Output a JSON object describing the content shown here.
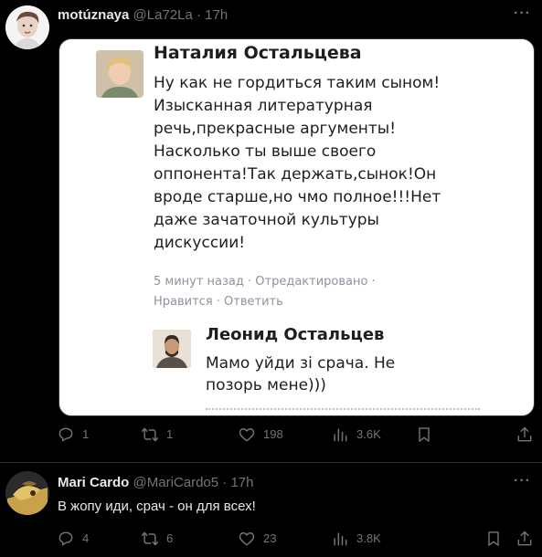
{
  "tweets": [
    {
      "author": {
        "name": "motúznaya",
        "handle": "@La72La",
        "time": "17h"
      },
      "more": "···",
      "embedded": {
        "comment": {
          "author": "Наталия Остальцева",
          "lines": [
            "Ну как не гордиться таким сыном!",
            "Изысканная литературная",
            "речь,прекрасные аргументы!",
            "Насколько ты выше своего",
            "оппонента!Так держать,сынок!Он",
            "вроде старше,но чмо полное!!!Нет",
            "даже зачаточной культуры",
            "дискуссии!"
          ],
          "meta1": "5 минут назад · Отредактировано ·",
          "meta2": "Нравится · Ответить"
        },
        "reply": {
          "author": "Леонид Остальцев",
          "lines": [
            "Мамо уйди зі срача. Не",
            "позорь мене)))"
          ]
        }
      },
      "actions": {
        "reply": "1",
        "retweet": "1",
        "like": "198",
        "views": "3.6K"
      }
    },
    {
      "author": {
        "name": "Mari Cardo",
        "handle": "@MariCardo5",
        "time": "17h"
      },
      "more": "···",
      "text": "В жопу иди, срач - он для всех!",
      "actions": {
        "reply": "4",
        "retweet": "6",
        "like": "23",
        "views": "3.8K"
      }
    }
  ],
  "colors": {
    "background": "#000000",
    "text": "#e7e9ea",
    "muted": "#71767b",
    "divider": "#2f3336"
  },
  "icons": [
    "reply-icon",
    "retweet-icon",
    "like-icon",
    "views-icon",
    "bookmark-icon",
    "share-icon",
    "more-icon"
  ]
}
